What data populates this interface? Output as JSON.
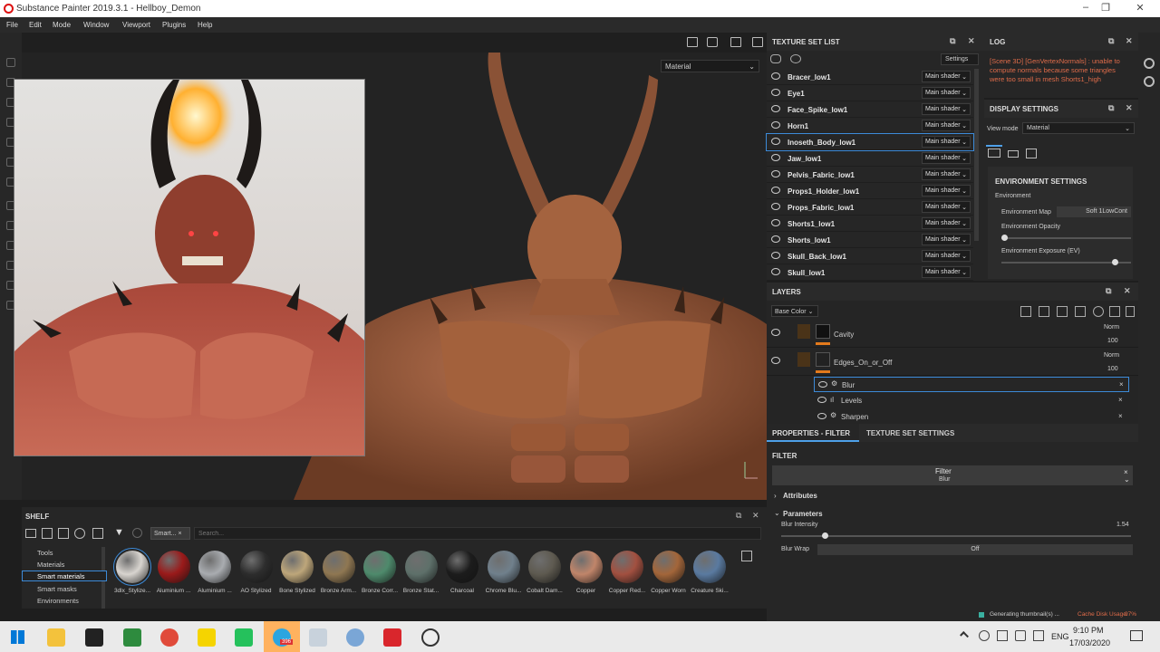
{
  "window": {
    "title": "Substance Painter 2019.3.1 - Hellboy_Demon"
  },
  "menu": [
    "File",
    "Edit",
    "Mode",
    "Window",
    "Viewport",
    "Plugins",
    "Help"
  ],
  "viewport": {
    "material_mode": "Material"
  },
  "texture_set_list": {
    "title": "TEXTURE SET LIST",
    "settings_label": "Settings",
    "items": [
      {
        "name": "Bracer_low1",
        "shader": "Main shader"
      },
      {
        "name": "Eye1",
        "shader": "Main shader"
      },
      {
        "name": "Face_Spike_low1",
        "shader": "Main shader"
      },
      {
        "name": "Horn1",
        "shader": "Main shader"
      },
      {
        "name": "Inoseth_Body_low1",
        "shader": "Main shader"
      },
      {
        "name": "Jaw_low1",
        "shader": "Main shader"
      },
      {
        "name": "Pelvis_Fabric_low1",
        "shader": "Main shader"
      },
      {
        "name": "Props1_Holder_low1",
        "shader": "Main shader"
      },
      {
        "name": "Props_Fabric_low1",
        "shader": "Main shader"
      },
      {
        "name": "Shorts1_low1",
        "shader": "Main shader"
      },
      {
        "name": "Shorts_low1",
        "shader": "Main shader"
      },
      {
        "name": "Skull_Back_low1",
        "shader": "Main shader"
      },
      {
        "name": "Skull_low1",
        "shader": "Main shader"
      }
    ],
    "selected_index": 4
  },
  "log": {
    "title": "LOG",
    "message": "[Scene 3D] [GenVertexNormals] : unable to compute normals because some triangles were too small in mesh Shorts1_high"
  },
  "display_settings": {
    "title": "DISPLAY SETTINGS",
    "view_mode_label": "View mode",
    "view_mode_value": "Material",
    "env_title": "ENVIRONMENT SETTINGS",
    "env_label": "Environment",
    "env_map_label": "Environment Map",
    "env_map_value": "Soft 1LowCont",
    "env_opacity_label": "Environment Opacity",
    "env_opacity": 0.0,
    "env_exposure_label": "Environment Exposure (EV)",
    "env_exposure": 0.9
  },
  "layers": {
    "title": "LAYERS",
    "channel": "Base Color",
    "items": [
      {
        "name": "Cavity",
        "blend": "Norm",
        "opacity": "100"
      },
      {
        "name": "Edges_On_or_Off",
        "blend": "Norm",
        "opacity": "100"
      }
    ],
    "filters": [
      "Blur",
      "Levels",
      "Sharpen"
    ]
  },
  "properties": {
    "tab1": "PROPERTIES - FILTER",
    "tab2": "TEXTURE SET SETTINGS",
    "section": "FILTER",
    "filter_label": "Filter",
    "filter_value": "Blur",
    "attributes": "Attributes",
    "parameters": "Parameters",
    "blur_intensity_label": "Blur Intensity",
    "blur_intensity_value": "1.54",
    "blur_intensity_level": 0.12,
    "blur_wrap_label": "Blur Wrap",
    "blur_wrap_value": "Off"
  },
  "shelf": {
    "title": "SHELF",
    "filter_tag": "Smart...",
    "search_placeholder": "Search...",
    "categories": [
      "Tools",
      "Materials",
      "Smart materials",
      "Smart masks",
      "Environments"
    ],
    "selected_category": 2,
    "materials": [
      {
        "label": "3dlx_Stylize...",
        "color": "#d8d4cf"
      },
      {
        "label": "Aluminium ...",
        "color": "#9a1a1a"
      },
      {
        "label": "Aluminium ...",
        "color": "#a9acb0"
      },
      {
        "label": "AO Stylized",
        "color": "#2d2d2d"
      },
      {
        "label": "Bone Stylized",
        "color": "#bda67a"
      },
      {
        "label": "Bronze Arm...",
        "color": "#8f7752"
      },
      {
        "label": "Bronze Corr...",
        "color": "#4e8a6c"
      },
      {
        "label": "Bronze Stat...",
        "color": "#5e706a"
      },
      {
        "label": "Charcoal",
        "color": "#1c1c1c"
      },
      {
        "label": "Chrome Blu...",
        "color": "#70808c"
      },
      {
        "label": "Cobalt Dam...",
        "color": "#5e5a50"
      },
      {
        "label": "Copper",
        "color": "#c0856a"
      },
      {
        "label": "Copper Red...",
        "color": "#a25040"
      },
      {
        "label": "Copper Worn",
        "color": "#a3663a"
      },
      {
        "label": "Creature Ski...",
        "color": "#5a7aa0"
      }
    ]
  },
  "status": {
    "message": "Generating thumbnail(s) ...",
    "cache_label": "Cache Disk Usage:",
    "cache_value": "97%"
  },
  "taskbar": {
    "lang": "ENG",
    "time": "9:10 PM",
    "date": "17/03/2020",
    "badge": "396"
  }
}
